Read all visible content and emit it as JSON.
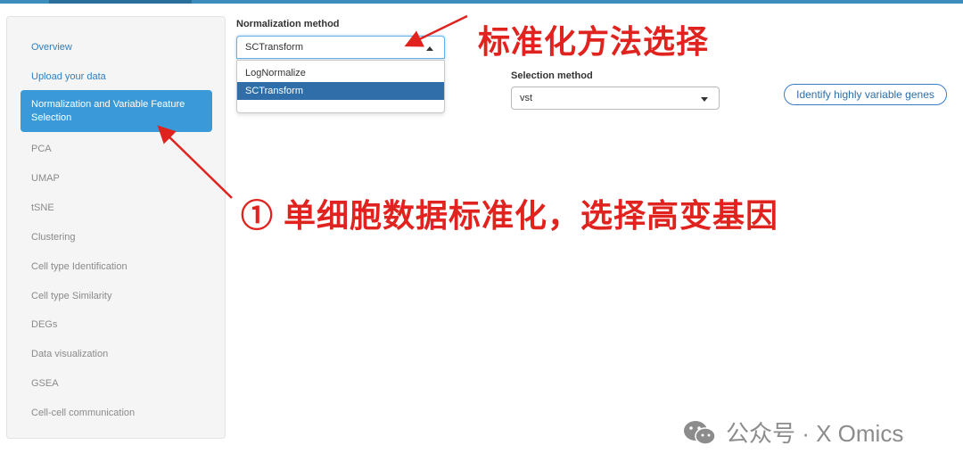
{
  "sidebar": {
    "items": [
      {
        "label": "Overview"
      },
      {
        "label": "Upload your data"
      },
      {
        "label": "Normalization and Variable Feature Selection"
      },
      {
        "label": "PCA"
      },
      {
        "label": "UMAP"
      },
      {
        "label": "tSNE"
      },
      {
        "label": "Clustering"
      },
      {
        "label": "Cell type Identification"
      },
      {
        "label": "Cell type Similarity"
      },
      {
        "label": "DEGs"
      },
      {
        "label": "Data visualization"
      },
      {
        "label": "GSEA"
      },
      {
        "label": "Cell-cell communication"
      }
    ],
    "active_index": 2
  },
  "normalization": {
    "label": "Normalization method",
    "value": "SCTransform",
    "options": [
      "LogNormalize",
      "SCTransform"
    ]
  },
  "selection": {
    "label": "Selection method",
    "value": "vst"
  },
  "identify_button": "Identify highly variable genes",
  "annotations": {
    "top": "标准化方法选择",
    "middle": "① 单细胞数据标准化，选择高变基因"
  },
  "watermark": "公众号 · X Omics",
  "colors": {
    "active": "#3a9ad9",
    "accent": "#2f6ea8",
    "annotation": "#e0231f"
  }
}
